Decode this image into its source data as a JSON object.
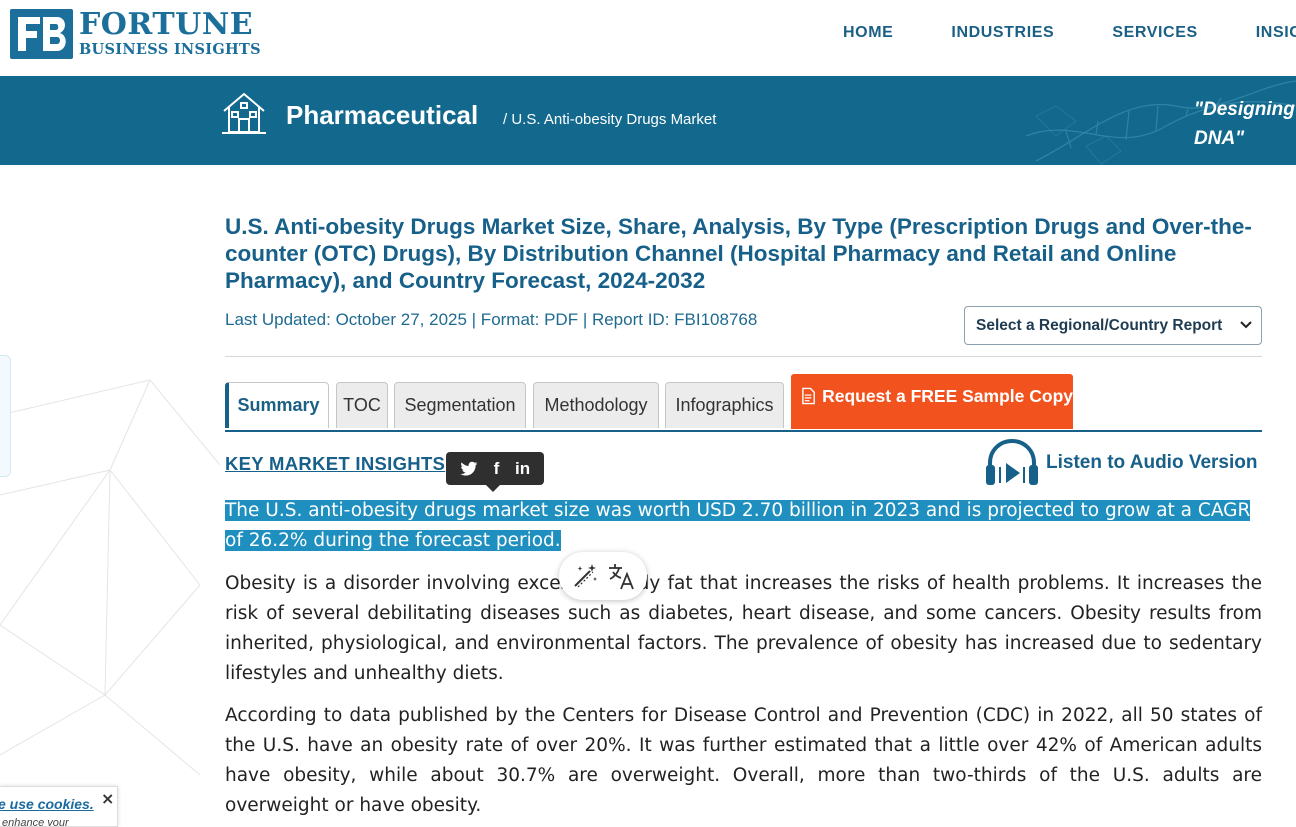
{
  "header": {
    "logo": {
      "line1": "FORTUNE",
      "line2": "BUSINESS INSIGHTS"
    },
    "nav": [
      "HOME",
      "INDUSTRIES",
      "SERVICES",
      "INSIGHT"
    ]
  },
  "banner": {
    "category": "Pharmaceutical",
    "breadcrumb": "/ U.S. Anti-obesity Drugs Market",
    "quote_line1": "\"Designing",
    "quote_line2": "DNA\"",
    "icon": "house-icon"
  },
  "report": {
    "title": "U.S. Anti-obesity Drugs Market Size, Share, Analysis, By Type (Prescription Drugs and Over-the-counter (OTC) Drugs), By Distribution Channel (Hospital Pharmacy and Retail and Online Pharmacy), and Country Forecast, 2024-2032",
    "meta": "Last Updated: October 27, 2025 | Format: PDF | Report ID: FBI108768",
    "region_select": "Select a Regional/Country Report"
  },
  "tabs": [
    "Summary",
    "TOC",
    "Segmentation",
    "Methodology",
    "Infographics"
  ],
  "active_tab": "Summary",
  "sample_button": {
    "prefix": "Request a ",
    "free": "FREE",
    "suffix": " Sample Copy"
  },
  "section": {
    "heading": "KEY MARKET INSIGHTS",
    "audio": "Listen to Audio Version",
    "share_icons": [
      "twitter-icon",
      "facebook-icon",
      "linkedin-icon"
    ]
  },
  "content": {
    "highlight_line1": "The U.S. anti-obesity drugs market size was worth USD 2.70 billion in 2023 and is projected to grow at a CAGR",
    "highlight_line2": "of 26.2% during the forecast period.",
    "para1": "Obesity is a disorder involving excessive body fat that increases the risks of health problems. It increases the risk of several debilitating diseases such as diabetes, heart disease, and some cancers. Obesity results from inherited, physiological, and environmental factors. The prevalence of obesity has increased due to sedentary lifestyles and unhealthy diets.",
    "para2": "According to data published by the Centers for Disease Control and Prevention (CDC) in 2022, all 50 states of the U.S. have an obesity rate of over 20%. It was further estimated that a little over 42% of American adults have obesity, while about 30.7% are overweight. Overall, more than two-thirds of the U.S. adults are overweight or have obesity."
  },
  "cookie": {
    "link": "e use cookies.",
    "text": "enhance your",
    "close": "×"
  },
  "colors": {
    "brand": "#17608a",
    "banner": "#12698d",
    "cta": "#f2521d",
    "highlight": "#1e8fbe"
  }
}
